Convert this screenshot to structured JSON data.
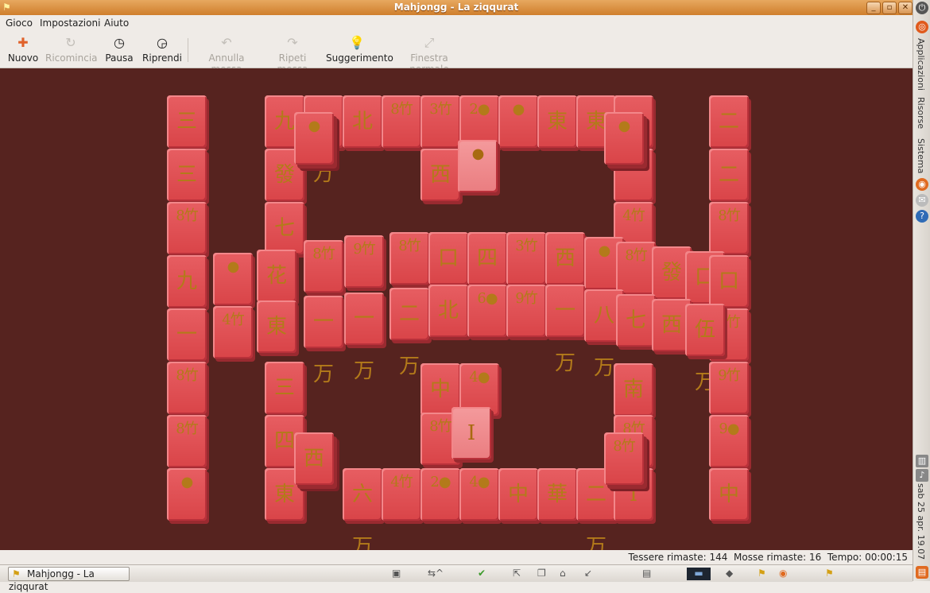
{
  "window": {
    "title": "Mahjongg - La ziqqurat"
  },
  "menu": {
    "items": [
      "Gioco",
      "Impostazioni",
      "Aiuto"
    ]
  },
  "toolbar": {
    "new_label": "Nuovo",
    "restart_label": "Ricomincia",
    "pause_label": "Pausa",
    "resume_label": "Riprendi",
    "undo_label": "Annulla mossa",
    "redo_label": "Ripeti mossa",
    "hint_label": "Suggerimento",
    "window_label": "Finestra normale"
  },
  "status": {
    "tiles_left_label": "Tessere rimaste:",
    "tiles_left": "144",
    "moves_left_label": "Mosse rimaste:",
    "moves_left": "16",
    "time_label": "Tempo:",
    "time": "00:00:15"
  },
  "taskbar": {
    "task_label": "Mahjongg - La ziqqurat"
  },
  "side_panel": {
    "menus": [
      "Applicazioni",
      "Risorse",
      "Sistema"
    ],
    "clock": "sab 25 apr. 19.07"
  },
  "tiles": [
    "三万",
    "三万",
    "8竹",
    "九万",
    "一万",
    "8竹",
    "8竹",
    "●",
    "九万",
    "四万",
    "北",
    "8竹",
    "3竹",
    "2●",
    "●",
    "東",
    "東",
    "二万",
    "發",
    "西",
    "●",
    "8竹",
    "4竹",
    "七万",
    "二万",
    "二万",
    "8竹",
    "●",
    "●",
    "●",
    "4竹",
    "花",
    "8竹",
    "9竹",
    "8竹",
    "口",
    "四万",
    "3竹",
    "西",
    "●",
    "8竹",
    "發",
    "口",
    "口",
    "8竹",
    "東",
    "一万",
    "一万",
    "二万",
    "北",
    "6●",
    "9竹",
    "一万",
    "八万",
    "七万",
    "西",
    "伍万",
    "9竹",
    "8竹",
    "三万",
    "中",
    "4●",
    "南",
    "9●",
    "6竹",
    "四万",
    "西",
    "8竹",
    "I",
    "8竹",
    "8竹",
    "●",
    "東",
    "六万",
    "4竹",
    "2●",
    "4●",
    "中",
    "華",
    "二万",
    "I",
    "中"
  ]
}
